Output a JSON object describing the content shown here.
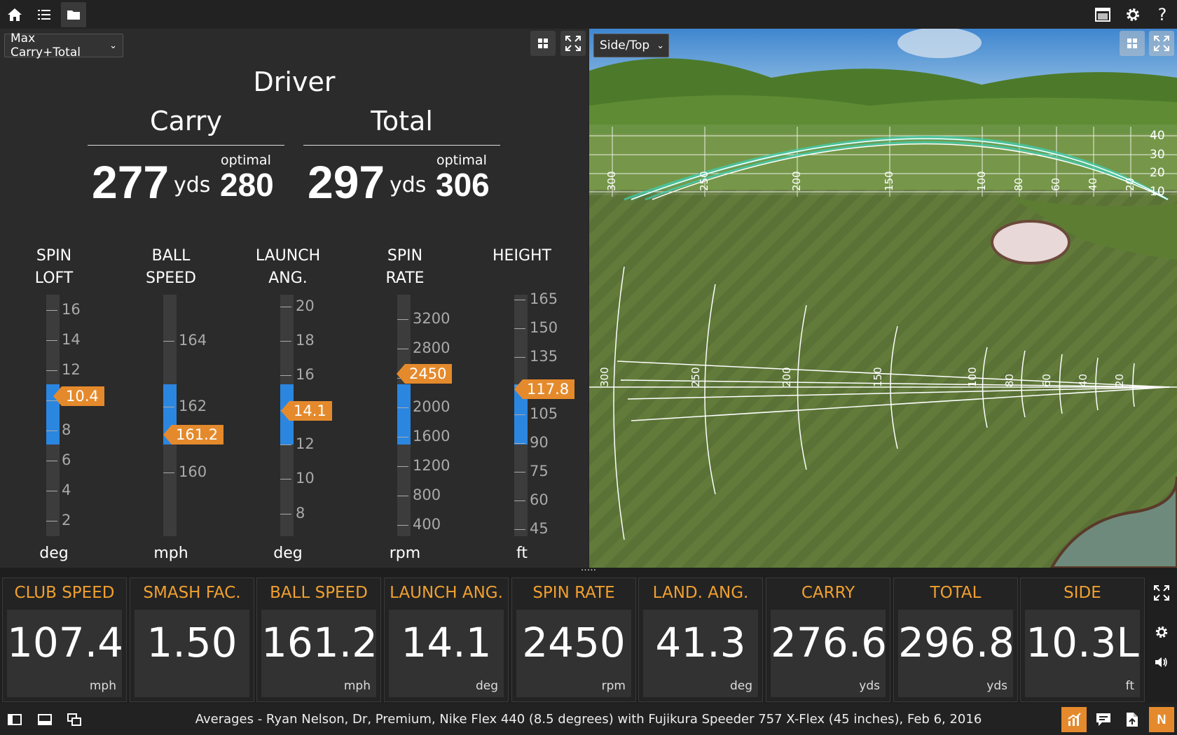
{
  "toolbar": {
    "icons": [
      "home-icon",
      "list-icon",
      "folder-icon",
      "window-icon",
      "gear-icon",
      "help-icon"
    ],
    "help_label": "?"
  },
  "left_panel": {
    "view_select": {
      "selected": "Max Carry+Total",
      "arrow": "⌄"
    },
    "club": "Driver",
    "carry": {
      "label": "Carry",
      "value": "277",
      "unit": "yds",
      "optimal_label": "optimal",
      "optimal_value": "280"
    },
    "total": {
      "label": "Total",
      "value": "297",
      "unit": "yds",
      "optimal_label": "optimal",
      "optimal_value": "306"
    },
    "gauges": [
      {
        "title1": "SPIN",
        "title2": "LOFT",
        "unit": "deg",
        "value": "10.4",
        "ticks": [
          "16",
          "14",
          "12",
          "10",
          "8",
          "6",
          "4",
          "2"
        ]
      },
      {
        "title1": "BALL",
        "title2": "SPEED",
        "unit": "mph",
        "value": "161.2",
        "ticks": [
          "164",
          "162",
          "160"
        ]
      },
      {
        "title1": "LAUNCH",
        "title2": "ANG.",
        "unit": "deg",
        "value": "14.1",
        "ticks": [
          "20",
          "18",
          "16",
          "14",
          "12",
          "10",
          "8"
        ]
      },
      {
        "title1": "SPIN",
        "title2": "RATE",
        "unit": "rpm",
        "value": "2450",
        "ticks": [
          "3200",
          "2800",
          "2400",
          "2000",
          "1600",
          "1200",
          "800",
          "400"
        ]
      },
      {
        "title1": "HEIGHT",
        "title2": "",
        "unit": "ft",
        "value": "117.8",
        "ticks": [
          "165",
          "150",
          "135",
          "120",
          "105",
          "90",
          "75",
          "60",
          "45"
        ]
      }
    ]
  },
  "right_panel": {
    "view_select": {
      "selected": "Side/Top",
      "arrow": "⌄"
    },
    "side_heights": [
      "40",
      "30",
      "20",
      "10"
    ],
    "distances": [
      "300",
      "250",
      "200",
      "150",
      "100",
      "80",
      "60",
      "40",
      "20"
    ]
  },
  "splitter_label": ".....",
  "stats": [
    {
      "label": "CLUB SPEED",
      "value": "107.4",
      "unit": "mph"
    },
    {
      "label": "SMASH FAC.",
      "value": "1.50",
      "unit": ""
    },
    {
      "label": "BALL SPEED",
      "value": "161.2",
      "unit": "mph"
    },
    {
      "label": "LAUNCH ANG.",
      "value": "14.1",
      "unit": "deg"
    },
    {
      "label": "SPIN RATE",
      "value": "2450",
      "unit": "rpm"
    },
    {
      "label": "LAND. ANG.",
      "value": "41.3",
      "unit": "deg"
    },
    {
      "label": "CARRY",
      "value": "276.6",
      "unit": "yds"
    },
    {
      "label": "TOTAL",
      "value": "296.8",
      "unit": "yds"
    },
    {
      "label": "SIDE",
      "value": "10.3L",
      "unit": "ft"
    }
  ],
  "status_bar": {
    "text": "Averages - Ryan Nelson, Dr, Premium, Nike Flex 440 (8.5 degrees) with Fujikura Speeder 757 X-Flex (45 inches), Feb 6, 2016",
    "badge": "N"
  },
  "colors": {
    "accent": "#e58a2c",
    "gauge_fill": "#2b86e0",
    "stat_label": "#f0a030"
  }
}
